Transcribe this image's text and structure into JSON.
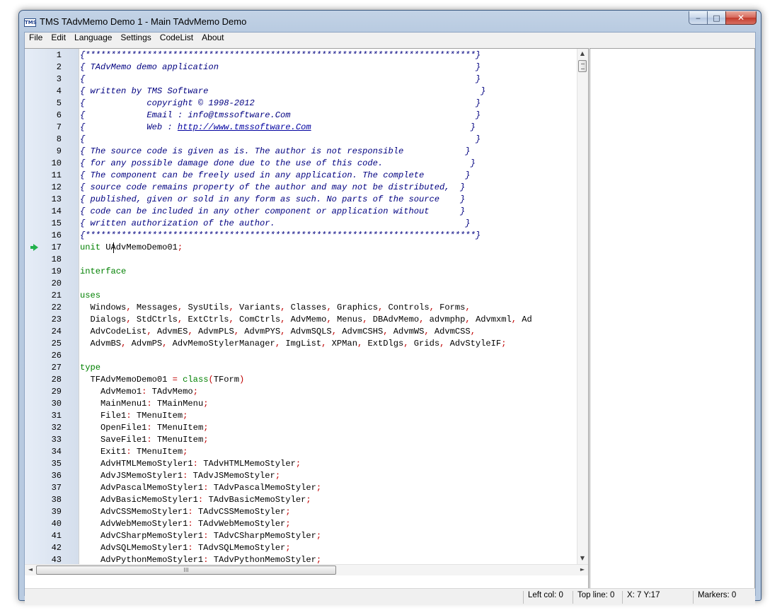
{
  "window": {
    "title": "TMS TAdvMemo Demo 1 - Main TAdvMemo Demo",
    "icon_label": "TMS",
    "buttons": {
      "minimize": "‒",
      "maximize": "□",
      "close": "✕"
    }
  },
  "menu": [
    "File",
    "Edit",
    "Language",
    "Settings",
    "CodeList",
    "About"
  ],
  "editor": {
    "active_line": 17,
    "lines": [
      {
        "n": 1,
        "type": "comment",
        "text": "{****************************************************************************}"
      },
      {
        "n": 2,
        "type": "comment",
        "text": "{ TAdvMemo demo application                                                  }"
      },
      {
        "n": 3,
        "type": "comment",
        "text": "{                                                                            }"
      },
      {
        "n": 4,
        "type": "comment",
        "text": "{ written by TMS Software                                                     }"
      },
      {
        "n": 5,
        "type": "comment",
        "text": "{            copyright © 1998-2012                                           }"
      },
      {
        "n": 6,
        "type": "comment",
        "text": "{            Email : info@tmssoftware.Com                                    }"
      },
      {
        "n": 7,
        "type": "url_comment",
        "pre": "{            Web : ",
        "url": "http://www.tmssoftware.Com",
        "post": "                               }"
      },
      {
        "n": 8,
        "type": "comment",
        "text": "{                                                                            }"
      },
      {
        "n": 9,
        "type": "comment",
        "text": "{ The source code is given as is. The author is not responsible            }"
      },
      {
        "n": 10,
        "type": "comment",
        "text": "{ for any possible damage done due to the use of this code.                 }"
      },
      {
        "n": 11,
        "type": "comment",
        "text": "{ The component can be freely used in any application. The complete        }"
      },
      {
        "n": 12,
        "type": "comment",
        "text": "{ source code remains property of the author and may not be distributed,  }"
      },
      {
        "n": 13,
        "type": "comment",
        "text": "{ published, given or sold in any form as such. No parts of the source    }"
      },
      {
        "n": 14,
        "type": "comment",
        "text": "{ code can be included in any other component or application without      }"
      },
      {
        "n": 15,
        "type": "comment",
        "text": "{ written authorization of the author.                                     }"
      },
      {
        "n": 16,
        "type": "comment",
        "text": "{****************************************************************************}"
      },
      {
        "n": 17,
        "type": "code",
        "parts": [
          [
            "kw",
            "unit"
          ],
          [
            "txt",
            " UAdvMemoDemo01"
          ],
          [
            "sym",
            ";"
          ]
        ]
      },
      {
        "n": 18,
        "type": "code",
        "parts": []
      },
      {
        "n": 19,
        "type": "code",
        "parts": [
          [
            "kw",
            "interface"
          ]
        ]
      },
      {
        "n": 20,
        "type": "code",
        "parts": []
      },
      {
        "n": 21,
        "type": "code",
        "parts": [
          [
            "kw",
            "uses"
          ]
        ]
      },
      {
        "n": 22,
        "type": "code",
        "parts": [
          [
            "txt",
            "  Windows"
          ],
          [
            "sym",
            ","
          ],
          [
            "txt",
            " Messages"
          ],
          [
            "sym",
            ","
          ],
          [
            "txt",
            " SysUtils"
          ],
          [
            "sym",
            ","
          ],
          [
            "txt",
            " Variants"
          ],
          [
            "sym",
            ","
          ],
          [
            "txt",
            " Classes"
          ],
          [
            "sym",
            ","
          ],
          [
            "txt",
            " Graphics"
          ],
          [
            "sym",
            ","
          ],
          [
            "txt",
            " Controls"
          ],
          [
            "sym",
            ","
          ],
          [
            "txt",
            " Forms"
          ],
          [
            "sym",
            ","
          ]
        ]
      },
      {
        "n": 23,
        "type": "code",
        "parts": [
          [
            "txt",
            "  Dialogs"
          ],
          [
            "sym",
            ","
          ],
          [
            "txt",
            " StdCtrls"
          ],
          [
            "sym",
            ","
          ],
          [
            "txt",
            " ExtCtrls"
          ],
          [
            "sym",
            ","
          ],
          [
            "txt",
            " ComCtrls"
          ],
          [
            "sym",
            ","
          ],
          [
            "txt",
            " AdvMemo"
          ],
          [
            "sym",
            ","
          ],
          [
            "txt",
            " Menus"
          ],
          [
            "sym",
            ","
          ],
          [
            "txt",
            " DBAdvMemo"
          ],
          [
            "sym",
            ","
          ],
          [
            "txt",
            " advmphp"
          ],
          [
            "sym",
            ","
          ],
          [
            "txt",
            " Advmxml"
          ],
          [
            "sym",
            ","
          ],
          [
            "txt",
            " Ad"
          ]
        ]
      },
      {
        "n": 24,
        "type": "code",
        "parts": [
          [
            "txt",
            "  AdvCodeList"
          ],
          [
            "sym",
            ","
          ],
          [
            "txt",
            " AdvmES"
          ],
          [
            "sym",
            ","
          ],
          [
            "txt",
            " AdvmPLS"
          ],
          [
            "sym",
            ","
          ],
          [
            "txt",
            " AdvmPYS"
          ],
          [
            "sym",
            ","
          ],
          [
            "txt",
            " AdvmSQLS"
          ],
          [
            "sym",
            ","
          ],
          [
            "txt",
            " AdvmCSHS"
          ],
          [
            "sym",
            ","
          ],
          [
            "txt",
            " AdvmWS"
          ],
          [
            "sym",
            ","
          ],
          [
            "txt",
            " AdvmCSS"
          ],
          [
            "sym",
            ","
          ]
        ]
      },
      {
        "n": 25,
        "type": "code",
        "parts": [
          [
            "txt",
            "  AdvmBS"
          ],
          [
            "sym",
            ","
          ],
          [
            "txt",
            " AdvmPS"
          ],
          [
            "sym",
            ","
          ],
          [
            "txt",
            " AdvMemoStylerManager"
          ],
          [
            "sym",
            ","
          ],
          [
            "txt",
            " ImgList"
          ],
          [
            "sym",
            ","
          ],
          [
            "txt",
            " XPMan"
          ],
          [
            "sym",
            ","
          ],
          [
            "txt",
            " ExtDlgs"
          ],
          [
            "sym",
            ","
          ],
          [
            "txt",
            " Grids"
          ],
          [
            "sym",
            ","
          ],
          [
            "txt",
            " AdvStyleIF"
          ],
          [
            "sym",
            ";"
          ]
        ]
      },
      {
        "n": 26,
        "type": "code",
        "parts": []
      },
      {
        "n": 27,
        "type": "code",
        "parts": [
          [
            "kw",
            "type"
          ]
        ]
      },
      {
        "n": 28,
        "type": "code",
        "parts": [
          [
            "txt",
            "  TFAdvMemoDemo01 "
          ],
          [
            "sym",
            "="
          ],
          [
            "txt",
            " "
          ],
          [
            "kw",
            "class"
          ],
          [
            "sym",
            "("
          ],
          [
            "txt",
            "TForm"
          ],
          [
            "sym",
            ")"
          ]
        ]
      },
      {
        "n": 29,
        "type": "code",
        "parts": [
          [
            "txt",
            "    AdvMemo1"
          ],
          [
            "sym",
            ":"
          ],
          [
            "txt",
            " TAdvMemo"
          ],
          [
            "sym",
            ";"
          ]
        ]
      },
      {
        "n": 30,
        "type": "code",
        "parts": [
          [
            "txt",
            "    MainMenu1"
          ],
          [
            "sym",
            ":"
          ],
          [
            "txt",
            " TMainMenu"
          ],
          [
            "sym",
            ";"
          ]
        ]
      },
      {
        "n": 31,
        "type": "code",
        "parts": [
          [
            "txt",
            "    File1"
          ],
          [
            "sym",
            ":"
          ],
          [
            "txt",
            " TMenuItem"
          ],
          [
            "sym",
            ";"
          ]
        ]
      },
      {
        "n": 32,
        "type": "code",
        "parts": [
          [
            "txt",
            "    OpenFile1"
          ],
          [
            "sym",
            ":"
          ],
          [
            "txt",
            " TMenuItem"
          ],
          [
            "sym",
            ";"
          ]
        ]
      },
      {
        "n": 33,
        "type": "code",
        "parts": [
          [
            "txt",
            "    SaveFile1"
          ],
          [
            "sym",
            ":"
          ],
          [
            "txt",
            " TMenuItem"
          ],
          [
            "sym",
            ";"
          ]
        ]
      },
      {
        "n": 34,
        "type": "code",
        "parts": [
          [
            "txt",
            "    Exit1"
          ],
          [
            "sym",
            ":"
          ],
          [
            "txt",
            " TMenuItem"
          ],
          [
            "sym",
            ";"
          ]
        ]
      },
      {
        "n": 35,
        "type": "code",
        "parts": [
          [
            "txt",
            "    AdvHTMLMemoStyler1"
          ],
          [
            "sym",
            ":"
          ],
          [
            "txt",
            " TAdvHTMLMemoStyler"
          ],
          [
            "sym",
            ";"
          ]
        ]
      },
      {
        "n": 36,
        "type": "code",
        "parts": [
          [
            "txt",
            "    AdvJSMemoStyler1"
          ],
          [
            "sym",
            ":"
          ],
          [
            "txt",
            " TAdvJSMemoStyler"
          ],
          [
            "sym",
            ";"
          ]
        ]
      },
      {
        "n": 37,
        "type": "code",
        "parts": [
          [
            "txt",
            "    AdvPascalMemoStyler1"
          ],
          [
            "sym",
            ":"
          ],
          [
            "txt",
            " TAdvPascalMemoStyler"
          ],
          [
            "sym",
            ";"
          ]
        ]
      },
      {
        "n": 38,
        "type": "code",
        "parts": [
          [
            "txt",
            "    AdvBasicMemoStyler1"
          ],
          [
            "sym",
            ":"
          ],
          [
            "txt",
            " TAdvBasicMemoStyler"
          ],
          [
            "sym",
            ";"
          ]
        ]
      },
      {
        "n": 39,
        "type": "code",
        "parts": [
          [
            "txt",
            "    AdvCSSMemoStyler1"
          ],
          [
            "sym",
            ":"
          ],
          [
            "txt",
            " TAdvCSSMemoStyler"
          ],
          [
            "sym",
            ";"
          ]
        ]
      },
      {
        "n": 40,
        "type": "code",
        "parts": [
          [
            "txt",
            "    AdvWebMemoStyler1"
          ],
          [
            "sym",
            ":"
          ],
          [
            "txt",
            " TAdvWebMemoStyler"
          ],
          [
            "sym",
            ";"
          ]
        ]
      },
      {
        "n": 41,
        "type": "code",
        "parts": [
          [
            "txt",
            "    AdvCSharpMemoStyler1"
          ],
          [
            "sym",
            ":"
          ],
          [
            "txt",
            " TAdvCSharpMemoStyler"
          ],
          [
            "sym",
            ";"
          ]
        ]
      },
      {
        "n": 42,
        "type": "code",
        "parts": [
          [
            "txt",
            "    AdvSQLMemoStyler1"
          ],
          [
            "sym",
            ":"
          ],
          [
            "txt",
            " TAdvSQLMemoStyler"
          ],
          [
            "sym",
            ";"
          ]
        ]
      },
      {
        "n": 43,
        "type": "code",
        "parts": [
          [
            "txt",
            "    AdvPythonMemoStyler1"
          ],
          [
            "sym",
            ":"
          ],
          [
            "txt",
            " TAdvPythonMemoStyler"
          ],
          [
            "sym",
            ";"
          ]
        ]
      }
    ]
  },
  "scrollbars": {
    "up": "▲",
    "down": "▼",
    "left": "◄",
    "right": "►",
    "grip": "III"
  },
  "status": {
    "left_col": "Left col: 0",
    "top_line": "Top line: 0",
    "xy": "X: 7  Y:17",
    "markers": "Markers: 0"
  },
  "colors": {
    "keyword": "#008000",
    "symbol": "#c00000",
    "comment": "#000080",
    "active_marker": "#22b14c"
  }
}
